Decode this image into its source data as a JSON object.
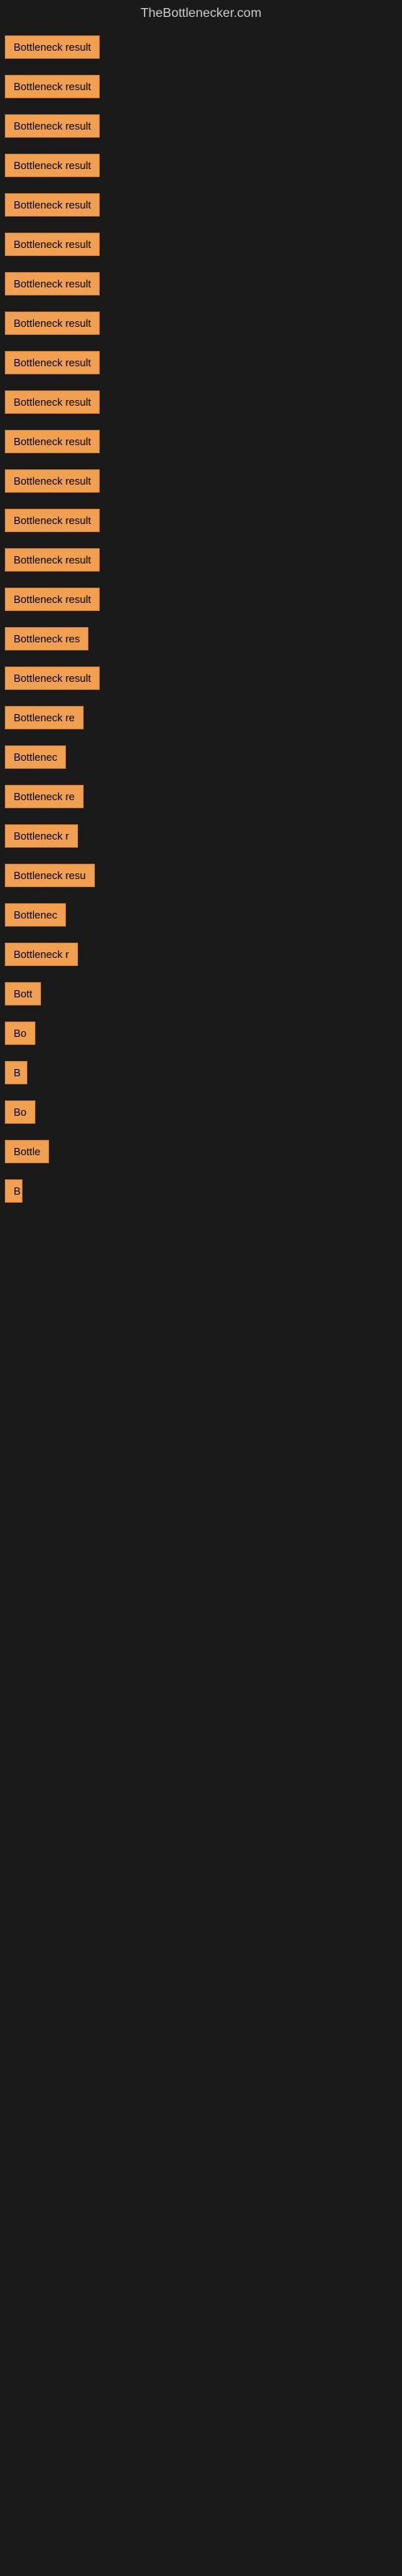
{
  "page": {
    "title": "TheBottlenecker.com",
    "items": [
      {
        "label": "Bottleneck result",
        "width": 155
      },
      {
        "label": "Bottleneck result",
        "width": 155
      },
      {
        "label": "Bottleneck result",
        "width": 155
      },
      {
        "label": "Bottleneck result",
        "width": 155
      },
      {
        "label": "Bottleneck result",
        "width": 155
      },
      {
        "label": "Bottleneck result",
        "width": 155
      },
      {
        "label": "Bottleneck result",
        "width": 155
      },
      {
        "label": "Bottleneck result",
        "width": 155
      },
      {
        "label": "Bottleneck result",
        "width": 155
      },
      {
        "label": "Bottleneck result",
        "width": 155
      },
      {
        "label": "Bottleneck result",
        "width": 155
      },
      {
        "label": "Bottleneck result",
        "width": 155
      },
      {
        "label": "Bottleneck result",
        "width": 155
      },
      {
        "label": "Bottleneck result",
        "width": 155
      },
      {
        "label": "Bottleneck result",
        "width": 155
      },
      {
        "label": "Bottleneck res",
        "width": 135
      },
      {
        "label": "Bottleneck result",
        "width": 148
      },
      {
        "label": "Bottleneck re",
        "width": 120
      },
      {
        "label": "Bottlenec",
        "width": 100
      },
      {
        "label": "Bottleneck re",
        "width": 120
      },
      {
        "label": "Bottleneck r",
        "width": 110
      },
      {
        "label": "Bottleneck resu",
        "width": 130
      },
      {
        "label": "Bottlenec",
        "width": 95
      },
      {
        "label": "Bottleneck r",
        "width": 108
      },
      {
        "label": "Bott",
        "width": 60
      },
      {
        "label": "Bo",
        "width": 48
      },
      {
        "label": "B",
        "width": 28
      },
      {
        "label": "Bo",
        "width": 44
      },
      {
        "label": "Bottle",
        "width": 70
      },
      {
        "label": "B",
        "width": 18
      }
    ]
  }
}
